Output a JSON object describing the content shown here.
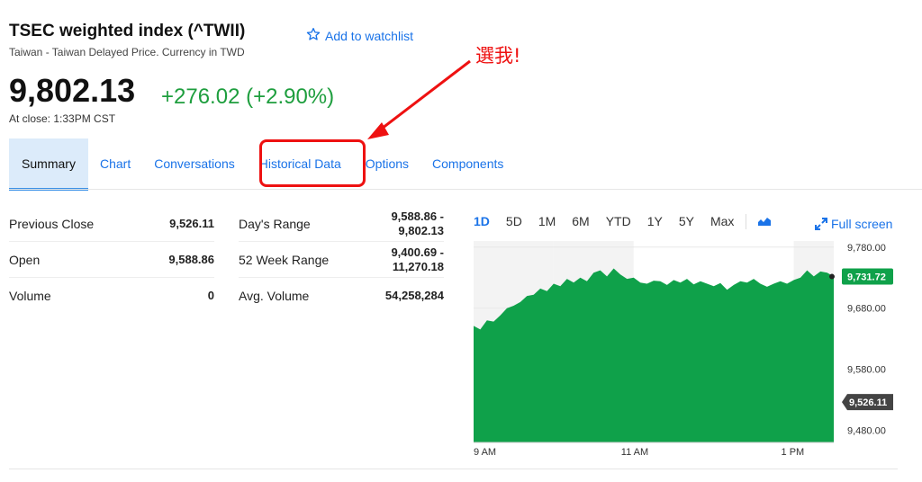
{
  "header": {
    "title": "TSEC weighted index (^TWII)",
    "subtitle": "Taiwan - Taiwan Delayed Price. Currency in TWD",
    "watchlist_label": "Add to watchlist",
    "price": "9,802.13",
    "change": "+276.02 (+2.90%)",
    "close_info": "At close: 1:33PM CST"
  },
  "tabs": [
    {
      "label": "Summary"
    },
    {
      "label": "Chart"
    },
    {
      "label": "Conversations"
    },
    {
      "label": "Historical Data"
    },
    {
      "label": "Options"
    },
    {
      "label": "Components"
    }
  ],
  "annotation": {
    "text": "選我!",
    "color": "#e11111"
  },
  "stats_left": [
    {
      "label": "Previous Close",
      "value": "9,526.11"
    },
    {
      "label": "Open",
      "value": "9,588.86"
    },
    {
      "label": "Volume",
      "value": "0"
    }
  ],
  "stats_right": [
    {
      "label": "Day's Range",
      "value1": "9,588.86 -",
      "value2": "9,802.13"
    },
    {
      "label": "52 Week Range",
      "value1": "9,400.69 -",
      "value2": "11,270.18"
    },
    {
      "label": "Avg. Volume",
      "value1": "54,258,284",
      "value2": ""
    }
  ],
  "chart_controls": {
    "ranges": [
      "1D",
      "5D",
      "1M",
      "6M",
      "YTD",
      "1Y",
      "5Y",
      "Max"
    ],
    "selected": "1D",
    "fullscreen_label": "Full screen"
  },
  "chart_data": {
    "type": "area",
    "color": "#0fa14a",
    "ylim": [
      9460,
      9790
    ],
    "y_ticks": [
      "9,780.00",
      "9,680.00",
      "9,580.00",
      "9,480.00"
    ],
    "y_tick_values": [
      9780,
      9680,
      9580,
      9480
    ],
    "x_ticks": [
      "9 AM",
      "11 AM",
      "1 PM"
    ],
    "x_tick_minutes": [
      0,
      120,
      240
    ],
    "x_range_minutes": [
      0,
      270
    ],
    "last_price_label": "9,731.72",
    "last_price": 9731.72,
    "prev_close_label": "9,526.11",
    "prev_close": 9526.11,
    "points": [
      [
        0,
        9651
      ],
      [
        5,
        9645
      ],
      [
        10,
        9660
      ],
      [
        15,
        9658
      ],
      [
        20,
        9668
      ],
      [
        25,
        9680
      ],
      [
        30,
        9684
      ],
      [
        35,
        9690
      ],
      [
        40,
        9700
      ],
      [
        45,
        9702
      ],
      [
        50,
        9712
      ],
      [
        55,
        9708
      ],
      [
        60,
        9720
      ],
      [
        65,
        9716
      ],
      [
        70,
        9728
      ],
      [
        75,
        9722
      ],
      [
        80,
        9730
      ],
      [
        85,
        9724
      ],
      [
        90,
        9738
      ],
      [
        95,
        9742
      ],
      [
        100,
        9732
      ],
      [
        105,
        9745
      ],
      [
        110,
        9735
      ],
      [
        115,
        9728
      ],
      [
        120,
        9730
      ],
      [
        125,
        9722
      ],
      [
        130,
        9720
      ],
      [
        135,
        9725
      ],
      [
        140,
        9724
      ],
      [
        145,
        9718
      ],
      [
        150,
        9726
      ],
      [
        155,
        9722
      ],
      [
        160,
        9728
      ],
      [
        165,
        9719
      ],
      [
        170,
        9724
      ],
      [
        175,
        9720
      ],
      [
        180,
        9716
      ],
      [
        185,
        9721
      ],
      [
        190,
        9710
      ],
      [
        195,
        9718
      ],
      [
        200,
        9724
      ],
      [
        205,
        9722
      ],
      [
        210,
        9728
      ],
      [
        215,
        9720
      ],
      [
        220,
        9715
      ],
      [
        225,
        9720
      ],
      [
        230,
        9724
      ],
      [
        235,
        9720
      ],
      [
        240,
        9726
      ],
      [
        245,
        9730
      ],
      [
        250,
        9742
      ],
      [
        255,
        9732
      ],
      [
        260,
        9740
      ],
      [
        265,
        9738
      ],
      [
        270,
        9732
      ]
    ]
  }
}
